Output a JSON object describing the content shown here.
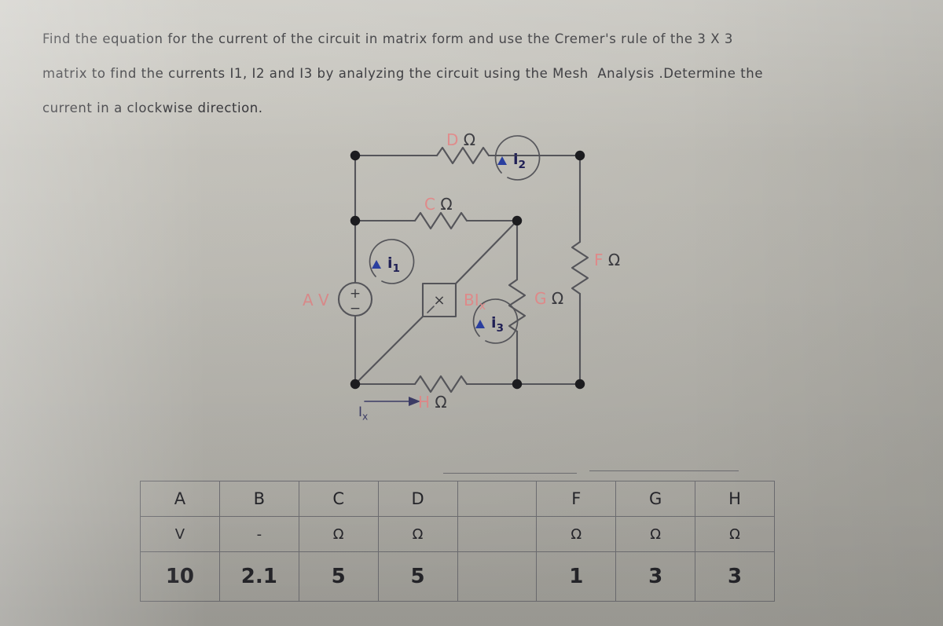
{
  "question": {
    "lines": [
      "Find the equation for the current of the circuit in matrix form and use the Cremer's rule of the 3 X 3",
      "matrix to find the currents I1, I2 and I3 by analyzing the circuit using the Mesh  Analysis .Determine the",
      "current in a clockwise direction."
    ]
  },
  "circuit": {
    "labels": {
      "source_voltage": "A V",
      "resistor_top": "D",
      "resistor_mid": "C",
      "resistor_right": "F",
      "resistor_center": "G",
      "resistor_bottom": "H",
      "ohm_symbol": "Ω",
      "dependent_source": "BI",
      "dependent_source_sub": "x",
      "dependent_source_glyph": "×",
      "branch_current": "I",
      "branch_current_sub": "x",
      "source_plus": "+",
      "source_minus": "-"
    },
    "mesh_currents": [
      {
        "name": "i",
        "sub": "1"
      },
      {
        "name": "i",
        "sub": "2"
      },
      {
        "name": "i",
        "sub": "3"
      }
    ],
    "colors": {
      "wire": "#55555a",
      "node": "#1c1c1f",
      "label_red": "#e08a8a",
      "label_dark": "#3b3b40",
      "mesh_blue": "#1f1f55",
      "arrow_blue": "#2a3fa0"
    }
  },
  "table": {
    "columns": [
      "A",
      "B",
      "C",
      "D",
      "",
      "F",
      "G",
      "H"
    ],
    "rows": [
      {
        "name": "header",
        "cells": [
          "A",
          "B",
          "C",
          "D",
          "",
          "F",
          "G",
          "H"
        ]
      },
      {
        "name": "units",
        "cells": [
          "V",
          "-",
          "Ω",
          "Ω",
          "",
          "Ω",
          "Ω",
          "Ω"
        ]
      },
      {
        "name": "values",
        "cells": [
          "10",
          "2.1",
          "5",
          "5",
          "",
          "1",
          "3",
          "3"
        ]
      }
    ]
  }
}
